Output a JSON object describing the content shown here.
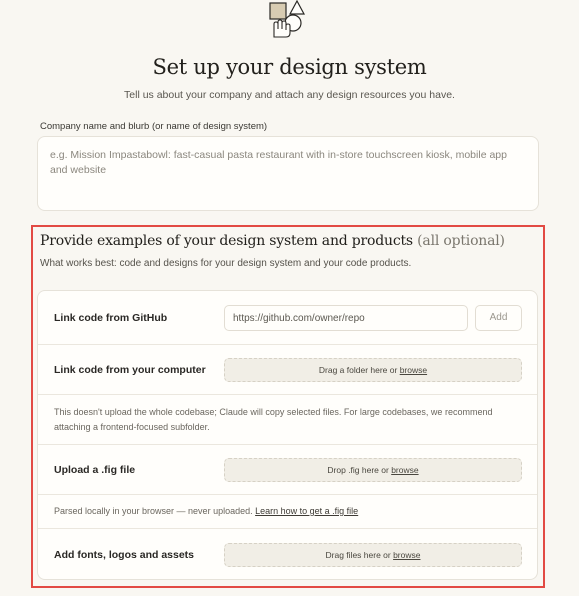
{
  "header": {
    "title": "Set up your design system",
    "subtitle": "Tell us about your company and attach any design resources you have."
  },
  "company": {
    "label": "Company name and blurb (or name of design system)",
    "placeholder": "e.g. Mission Impastabowl: fast-casual pasta restaurant with in-store touchscreen kiosk, mobile app and website"
  },
  "examples": {
    "title": "Provide examples of your design system and products",
    "title_optional": "(all optional)",
    "subtitle": "What works best: code and designs for your design system and your code products.",
    "github": {
      "label": "Link code from GitHub",
      "placeholder": "https://github.com/owner/repo",
      "add_label": "Add"
    },
    "computer": {
      "label": "Link code from your computer",
      "drop_text": "Drag a folder here or ",
      "drop_link": "browse",
      "note": "This doesn't upload the whole codebase; Claude will copy selected files. For large codebases, we recommend attaching a frontend-focused subfolder."
    },
    "fig": {
      "label": "Upload a .fig file",
      "drop_text": "Drop .fig here or ",
      "drop_link": "browse",
      "note": "Parsed locally in your browser — never uploaded. ",
      "note_link": "Learn how to get a .fig file"
    },
    "assets": {
      "label": "Add fonts, logos and assets",
      "drop_text": "Drag files here or ",
      "drop_link": "browse"
    }
  },
  "colors": {
    "background": "#f9f7f2",
    "highlight": "#e24a44"
  }
}
